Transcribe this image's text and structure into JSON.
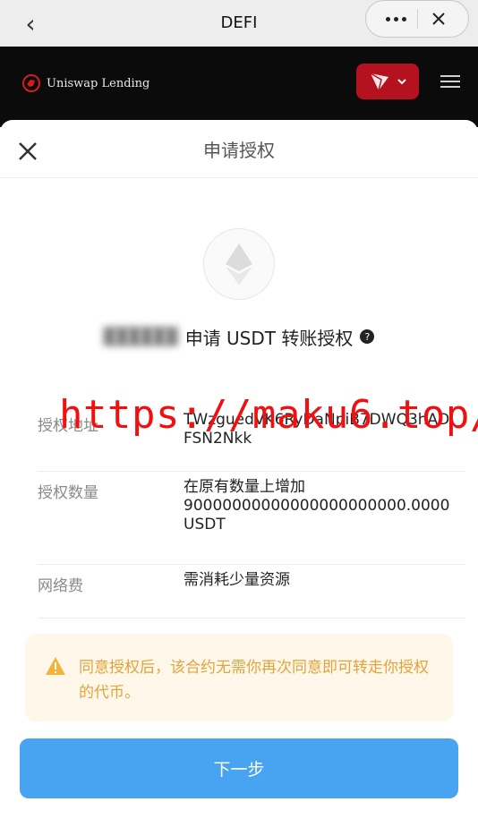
{
  "top_bar": {
    "title": "DEFI",
    "back_icon": "chevron-left-icon",
    "more_icon": "more-dots-icon",
    "close_icon": "close-icon"
  },
  "dapp_header": {
    "logo_text": "Uniswap Lending",
    "network_icon": "tron-icon",
    "accent": "#b4121e"
  },
  "sheet": {
    "title": "申请授权",
    "close_icon": "close-icon",
    "token_icon": "ethereum-icon",
    "request_name": "██████",
    "request_text": "申请 USDT 转账授权",
    "help_icon": "question-icon",
    "rows": [
      {
        "label": "授权地址",
        "value": "TWzguedVK6RyDaNpiB7DWQ3hADFSN2Nkk"
      },
      {
        "label": "授权数量",
        "value_line1": "在原有数量上增加",
        "value_line2": "90000000000000000000000.0000",
        "value_line3": "USDT"
      },
      {
        "label": "网络费",
        "value": "需消耗少量资源"
      }
    ],
    "warning": {
      "icon": "warning-icon",
      "text": "同意授权后，该合约无需你再次同意即可转走你授权的代币。",
      "color": "#e2a33a"
    },
    "next_button": "下一步",
    "next_button_color": "#48a4f0"
  },
  "overlay": {
    "url": "https://maku6.top/",
    "color": "#f10f0f"
  }
}
